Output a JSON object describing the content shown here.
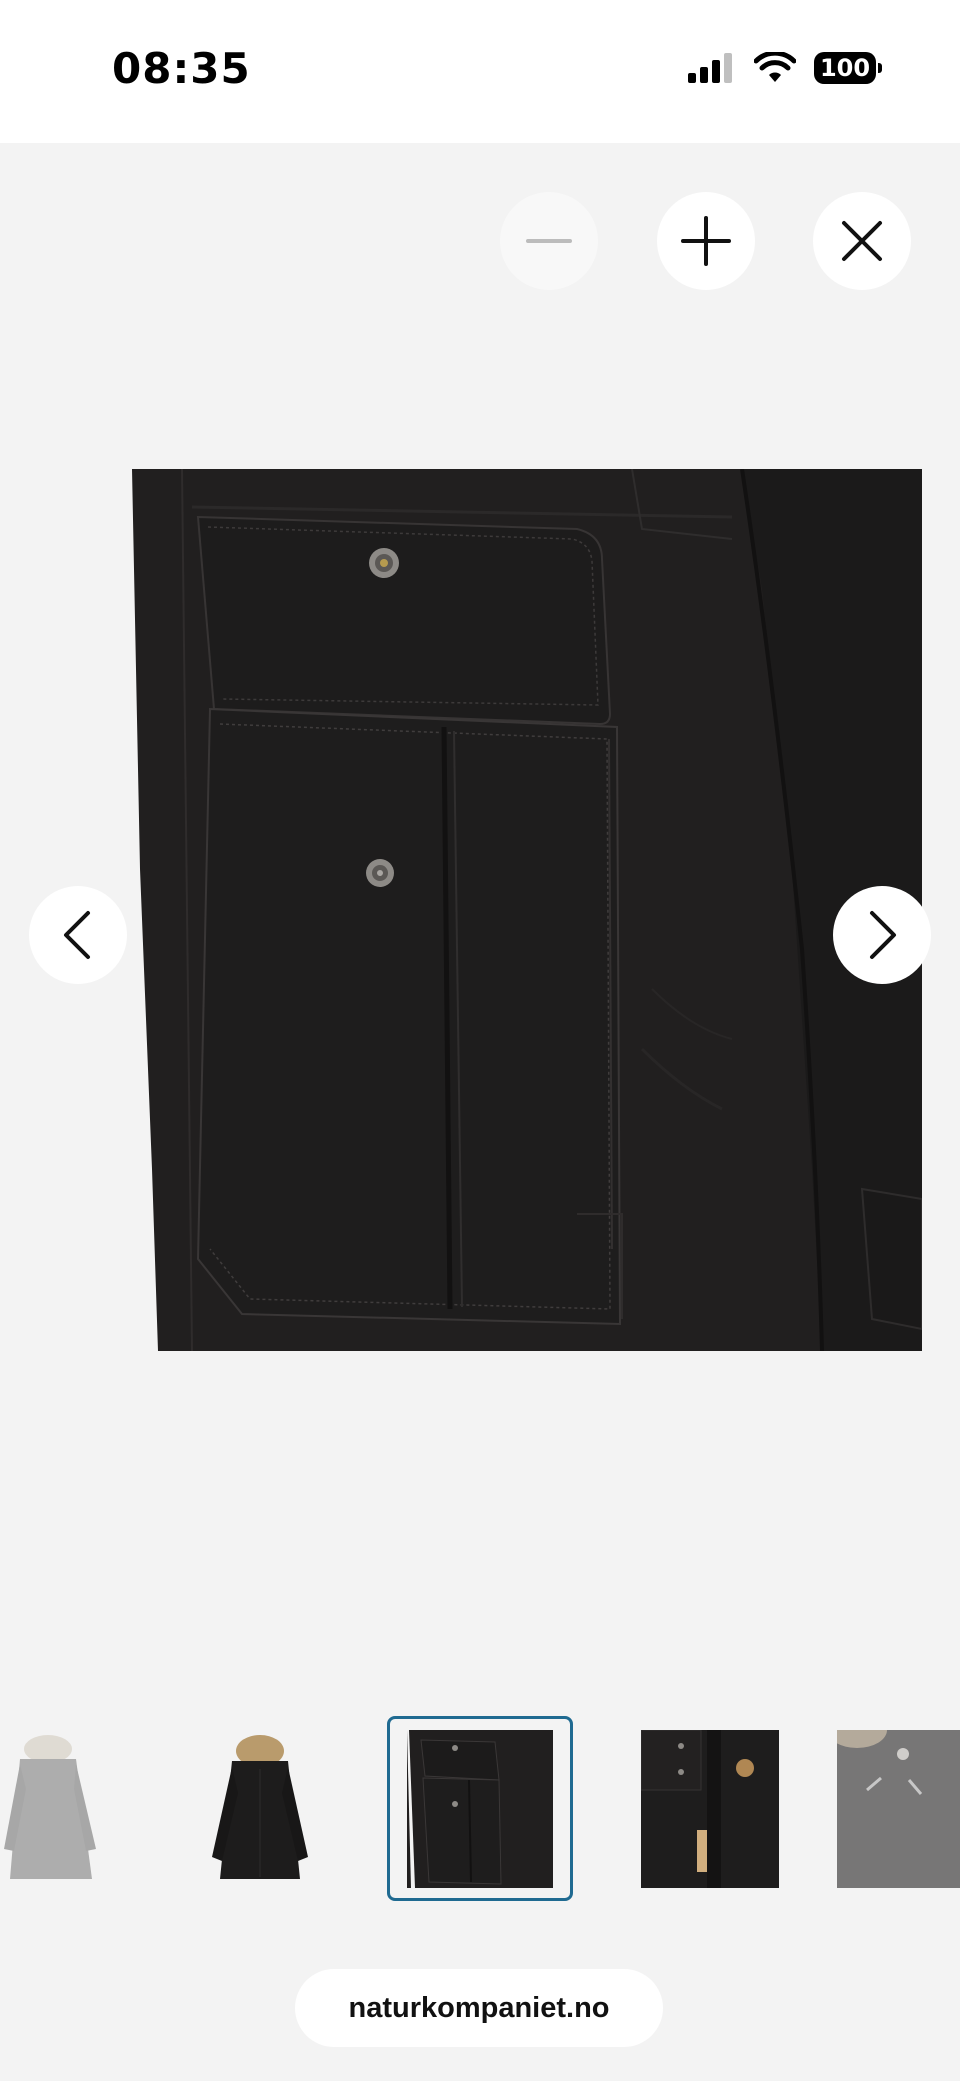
{
  "status_bar": {
    "time": "08:35",
    "battery": "100",
    "icons": [
      "cellular-signal-icon",
      "wifi-icon",
      "battery-icon"
    ]
  },
  "viewer": {
    "controls": {
      "zoom_out": "minus-icon",
      "zoom_in": "plus-icon",
      "close": "close-icon",
      "previous": "chevron-left-icon",
      "next": "chevron-right-icon"
    },
    "main_image": "jacket-pocket-closeup",
    "thumbnails": [
      {
        "image": "parka-grey-front",
        "selected": false
      },
      {
        "image": "parka-black-back",
        "selected": false
      },
      {
        "image": "parka-pocket-closeup",
        "selected": true
      },
      {
        "image": "parka-zipper-detail",
        "selected": false
      },
      {
        "image": "parka-collar-detail",
        "selected": false
      }
    ]
  },
  "browser": {
    "url": "naturkompaniet.no"
  },
  "colors": {
    "background": "#f3f3f3",
    "selected_thumbnail_border": "#1f6a91",
    "fabric": "#211f1f"
  }
}
